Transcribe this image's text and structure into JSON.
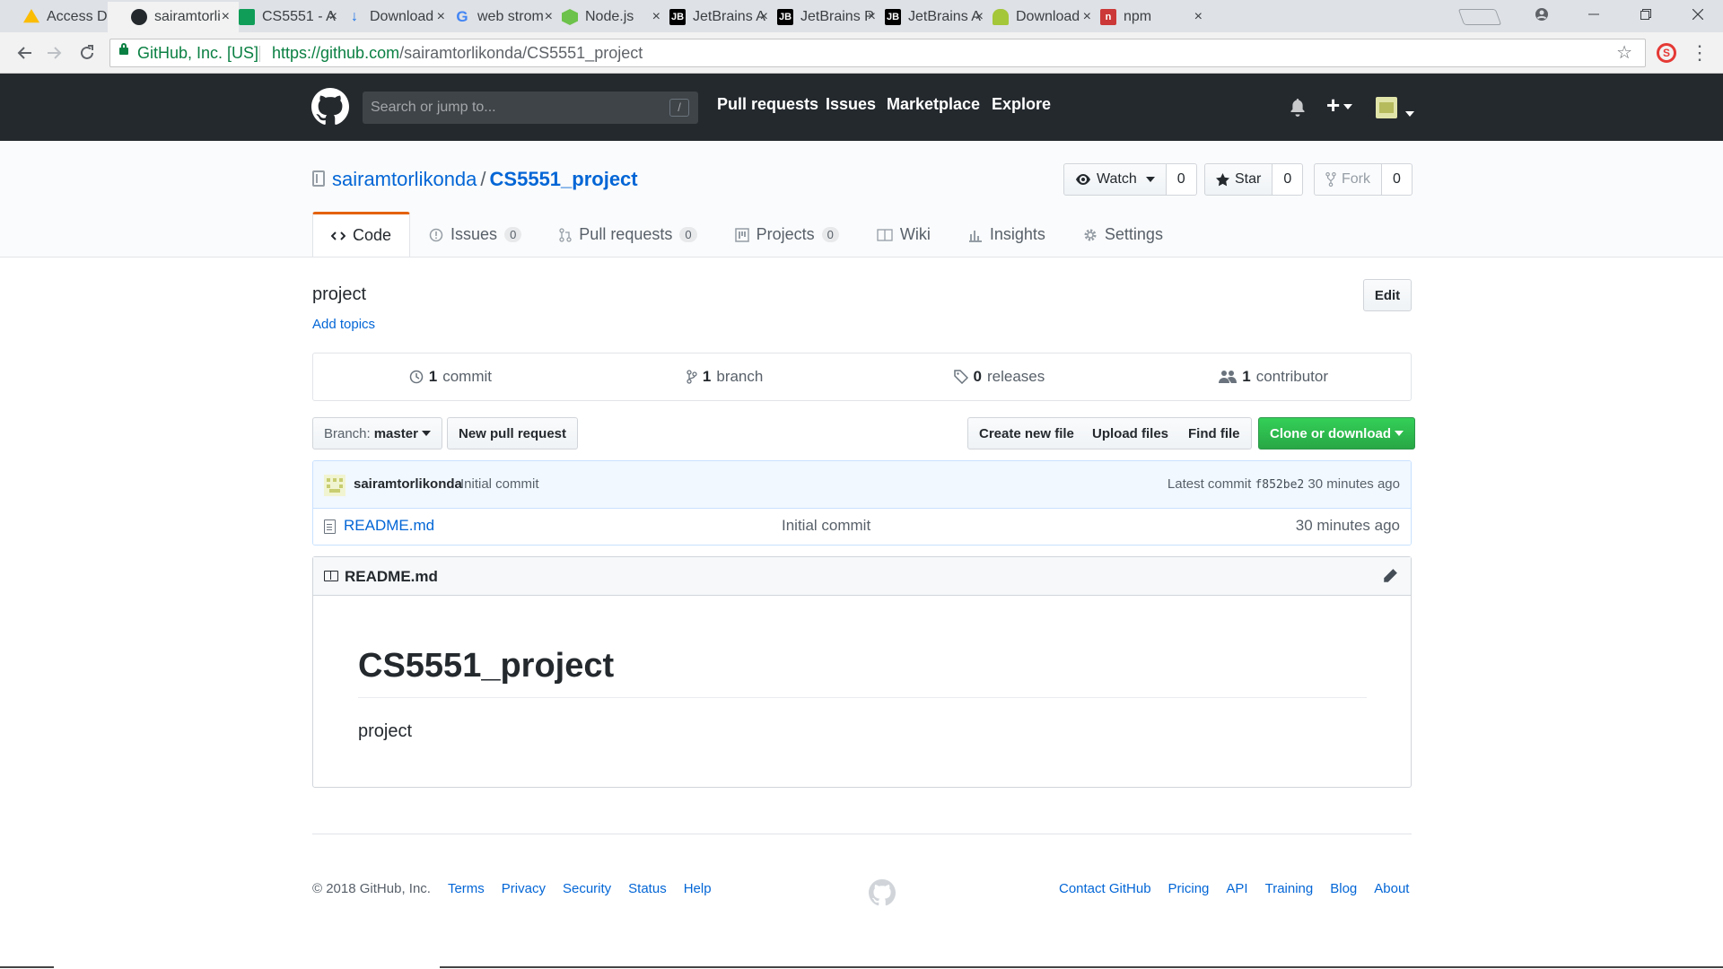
{
  "browser": {
    "tabs": [
      {
        "label": "Access Den",
        "icon": "google-drive-icon",
        "color": "#34a853"
      },
      {
        "label": "sairamtorli",
        "icon": "github-icon",
        "color": "#24292e",
        "active": true
      },
      {
        "label": "CS5551 - A",
        "icon": "google-sheets-icon",
        "color": "#0f9d58"
      },
      {
        "label": "Download",
        "icon": "download-icon",
        "color": "#1a73e8"
      },
      {
        "label": "web strom",
        "icon": "google-icon",
        "color": "#4285f4"
      },
      {
        "label": "Node.js",
        "icon": "nodejs-icon",
        "color": "#6cc24a"
      },
      {
        "label": "JetBrains A",
        "icon": "jetbrains-icon",
        "color": "#000000"
      },
      {
        "label": "JetBrains P",
        "icon": "jetbrains-icon",
        "color": "#000000"
      },
      {
        "label": "JetBrains A",
        "icon": "jetbrains-icon",
        "color": "#000000"
      },
      {
        "label": "Download",
        "icon": "android-icon",
        "color": "#a4c639"
      },
      {
        "label": "npm",
        "icon": "npm-icon",
        "color": "#cb3837"
      }
    ],
    "tab_close": "×",
    "jb_mark": "JB",
    "npm_mark": "n",
    "omnibox": {
      "org": "GitHub, Inc. [US]",
      "url_host": "https://github.com",
      "url_path": "/sairamtorlikonda/CS5551_project"
    },
    "ext_mark": "S"
  },
  "header": {
    "search_placeholder": "Search or jump to...",
    "search_shortcut": "/",
    "nav": [
      "Pull requests",
      "Issues",
      "Marketplace",
      "Explore"
    ],
    "plus": "+"
  },
  "repo": {
    "owner": "sairamtorlikonda",
    "separator": "/",
    "name": "CS5551_project",
    "watch": {
      "label": "Watch",
      "count": "0"
    },
    "star": {
      "label": "Star",
      "count": "0"
    },
    "fork": {
      "label": "Fork",
      "count": "0"
    },
    "tabs": [
      {
        "label": "Code",
        "icon": "code-icon"
      },
      {
        "label": "Issues",
        "icon": "issue-icon",
        "count": "0"
      },
      {
        "label": "Pull requests",
        "icon": "pull-request-icon",
        "count": "0"
      },
      {
        "label": "Projects",
        "icon": "project-icon",
        "count": "0"
      },
      {
        "label": "Wiki",
        "icon": "book-icon"
      },
      {
        "label": "Insights",
        "icon": "graph-icon"
      },
      {
        "label": "Settings",
        "icon": "gear-icon"
      }
    ],
    "description": "project",
    "add_topics": "Add topics",
    "edit": "Edit",
    "numbers": [
      {
        "value": "1",
        "label": "commit",
        "icon": "history-icon"
      },
      {
        "value": "1",
        "label": "branch",
        "icon": "branch-icon"
      },
      {
        "value": "0",
        "label": "releases",
        "icon": "tag-icon"
      },
      {
        "value": "1",
        "label": "contributor",
        "icon": "people-icon"
      }
    ],
    "branch_prefix": "Branch:",
    "branch": "master",
    "new_pr": "New pull request",
    "create_file": "Create new file",
    "upload_files": "Upload files",
    "find_file": "Find file",
    "clone": "Clone or download",
    "latest_commit": {
      "author": "sairamtorlikonda",
      "message": "Initial commit",
      "prefix": "Latest commit",
      "sha": "f852be2",
      "age": "30 minutes ago"
    },
    "files": [
      {
        "name": "README.md",
        "message": "Initial commit",
        "age": "30 minutes ago"
      }
    ],
    "readme": {
      "filename": "README.md",
      "heading": "CS5551_project",
      "body": "project"
    }
  },
  "footer": {
    "copyright": "© 2018 GitHub, Inc.",
    "left_links": [
      "Terms",
      "Privacy",
      "Security",
      "Status",
      "Help"
    ],
    "right_links": [
      "Contact GitHub",
      "Pricing",
      "API",
      "Training",
      "Blog",
      "About"
    ]
  }
}
